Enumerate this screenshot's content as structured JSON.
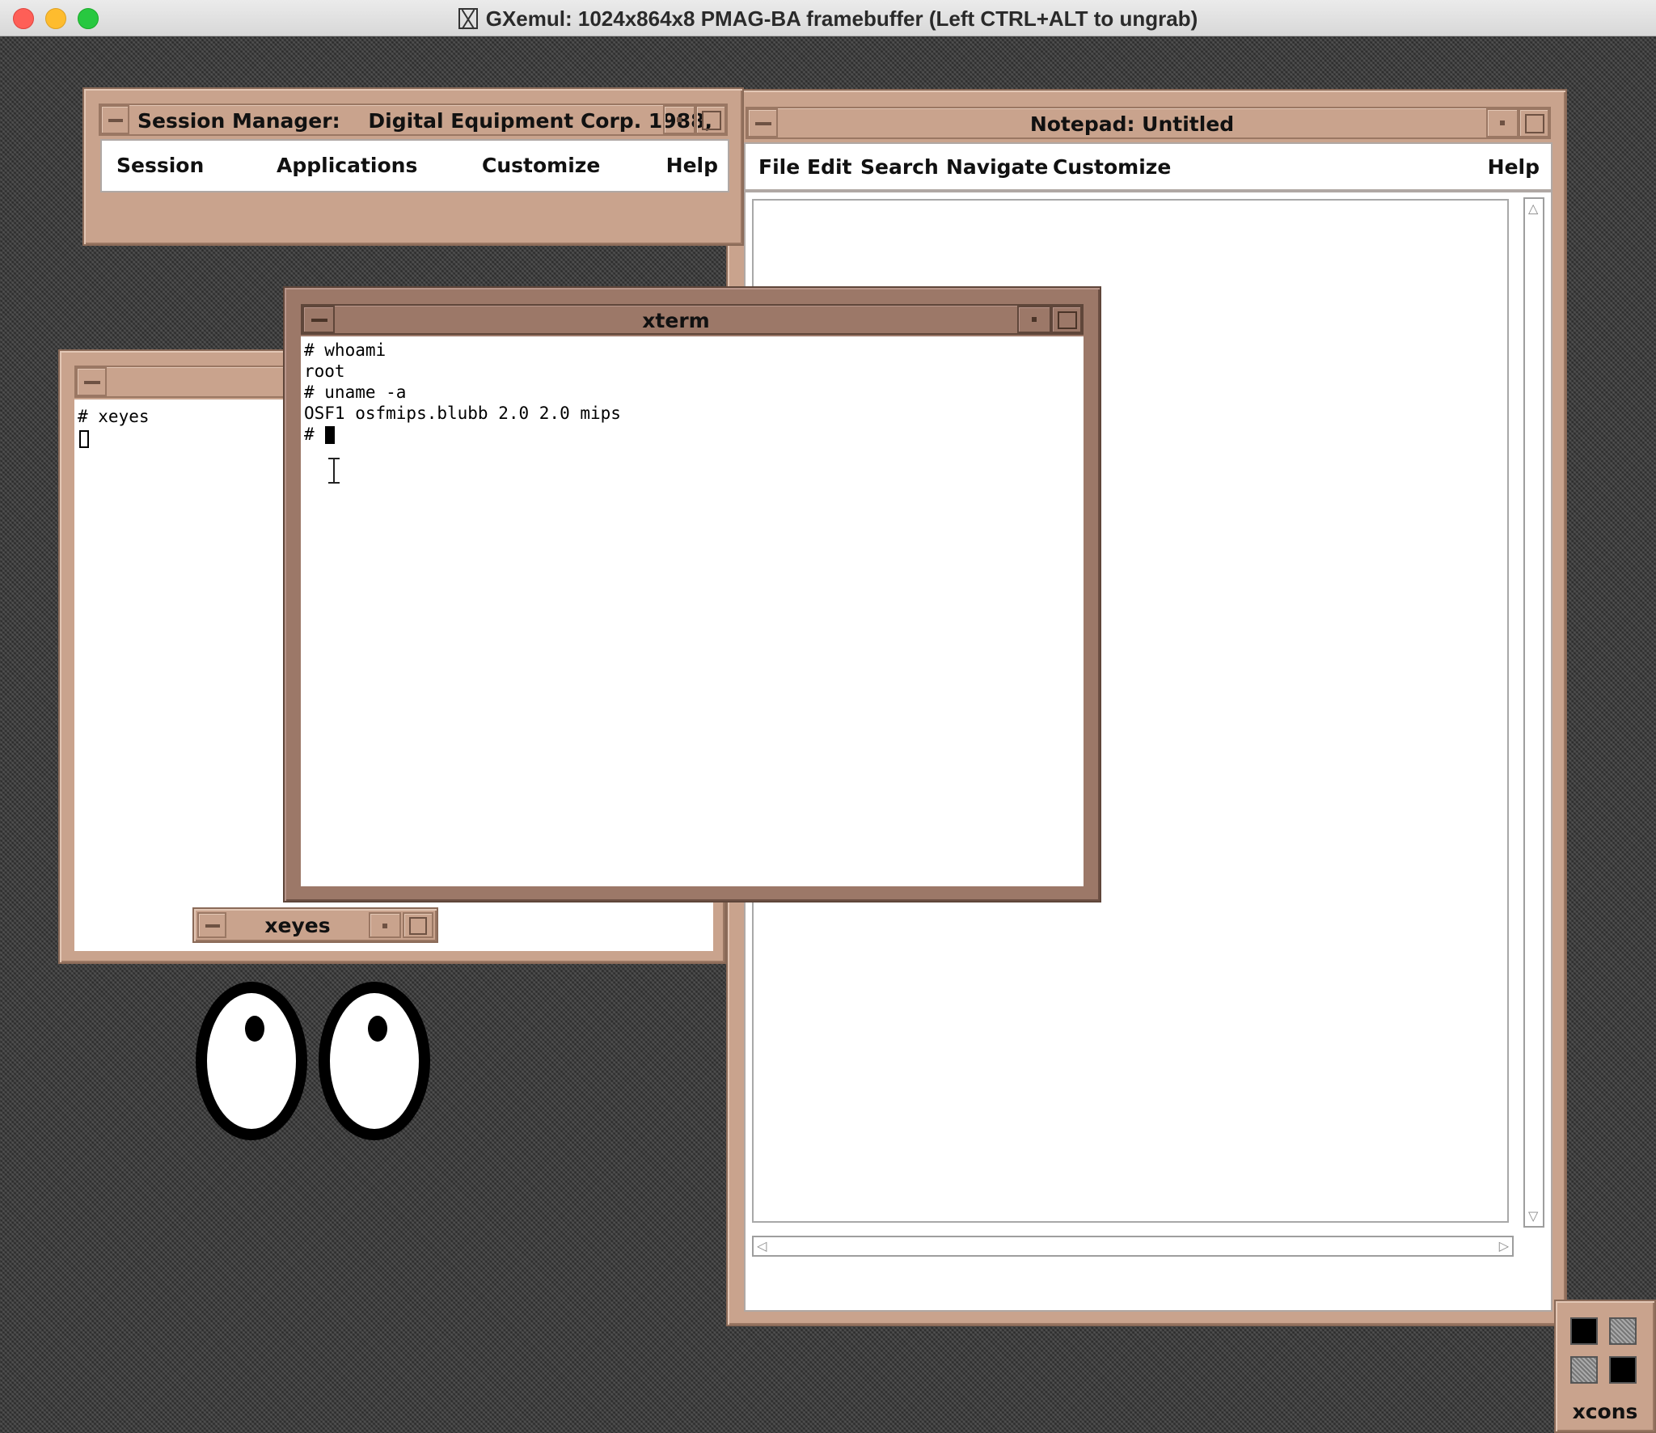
{
  "host_window": {
    "title": "GXemul: 1024x864x8 PMAG-BA framebuffer (Left CTRL+ALT to ungrab)"
  },
  "session_manager": {
    "title": "Session Manager:    Digital Equipment Corp. 1988,",
    "menu": [
      "Session",
      "Applications",
      "Customize",
      "Help"
    ]
  },
  "notepad": {
    "title": "Notepad: Untitled",
    "menu_left": [
      "File",
      "Edit",
      "Search",
      "Navigate",
      "Customize"
    ],
    "menu_help": "Help"
  },
  "xterm": {
    "title": "xterm",
    "lines": [
      "# whoami",
      "root",
      "# uname -a",
      "OSF1 osfmips.blubb 2.0 2.0 mips",
      "# "
    ]
  },
  "back_terminal": {
    "lines": [
      "# xeyes"
    ]
  },
  "xeyes": {
    "title": "xeyes"
  },
  "xcons": {
    "label": "xcons"
  },
  "colors": {
    "frame": "#c9a38d",
    "frame_active": "#9c7868",
    "desktop": "#3c3c3c"
  }
}
